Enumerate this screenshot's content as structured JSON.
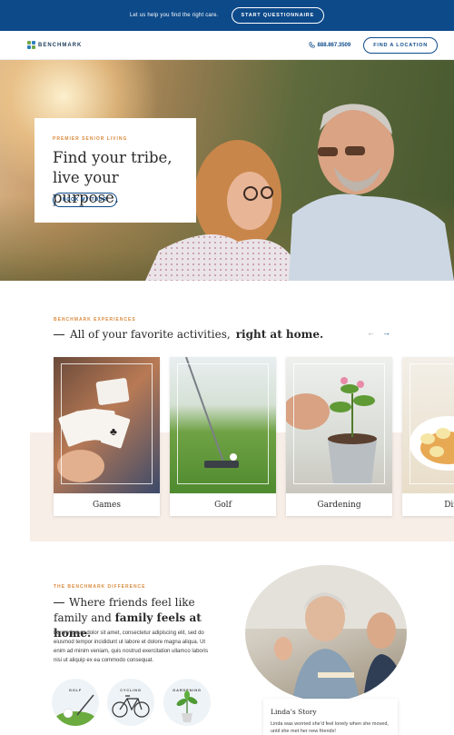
{
  "topbar": {
    "text": "Let us help you find the right care.",
    "button": "START QUESTIONNAIRE"
  },
  "header": {
    "brand": "BENCHMARK",
    "phone": "888.867.3509",
    "cta": "FIND A LOCATION"
  },
  "hero": {
    "eyebrow": "PREMIER SENIOR LIVING",
    "title_line1": "Find your tribe,",
    "title_line2": "live your purpose.",
    "button": "BOOK MY TOUR"
  },
  "experiences": {
    "eyebrow": "BENCHMARK EXPERIENCES",
    "title_plain": "All of your favorite activities,",
    "title_bold": "right at home.",
    "prev": "←",
    "next": "→",
    "activities": [
      {
        "label": "Games"
      },
      {
        "label": "Golf"
      },
      {
        "label": "Gardening"
      },
      {
        "label": "Dinin"
      }
    ]
  },
  "difference": {
    "eyebrow": "THE BENCHMARK DIFFERENCE",
    "title_a": "Where friends feel like",
    "title_b": "family and",
    "title_bold": "family feels at home.",
    "body": "Lorem ipsum dolor sit amet, consectetur adipiscing elit, sed do eiusmod tempor incididunt ut labore et dolore magna aliqua. Ut enim ad minim veniam, quis nostrud exercitation ullamco laboris nisi ut aliquip ex ea commodo consequat.",
    "icons": [
      {
        "label": "GOLF",
        "icon": "golf-icon"
      },
      {
        "label": "CYCLING",
        "icon": "bicycle-icon"
      },
      {
        "label": "GARDENING",
        "icon": "plant-icon"
      }
    ]
  },
  "story": {
    "title": "Linda’s Story",
    "body": "Linda was worried she’d feel lonely when she moved, until she met her new friends!"
  },
  "colors": {
    "brand_blue": "#0d4a8a",
    "accent_orange": "#d98a3d",
    "blush": "#f7eee8"
  }
}
